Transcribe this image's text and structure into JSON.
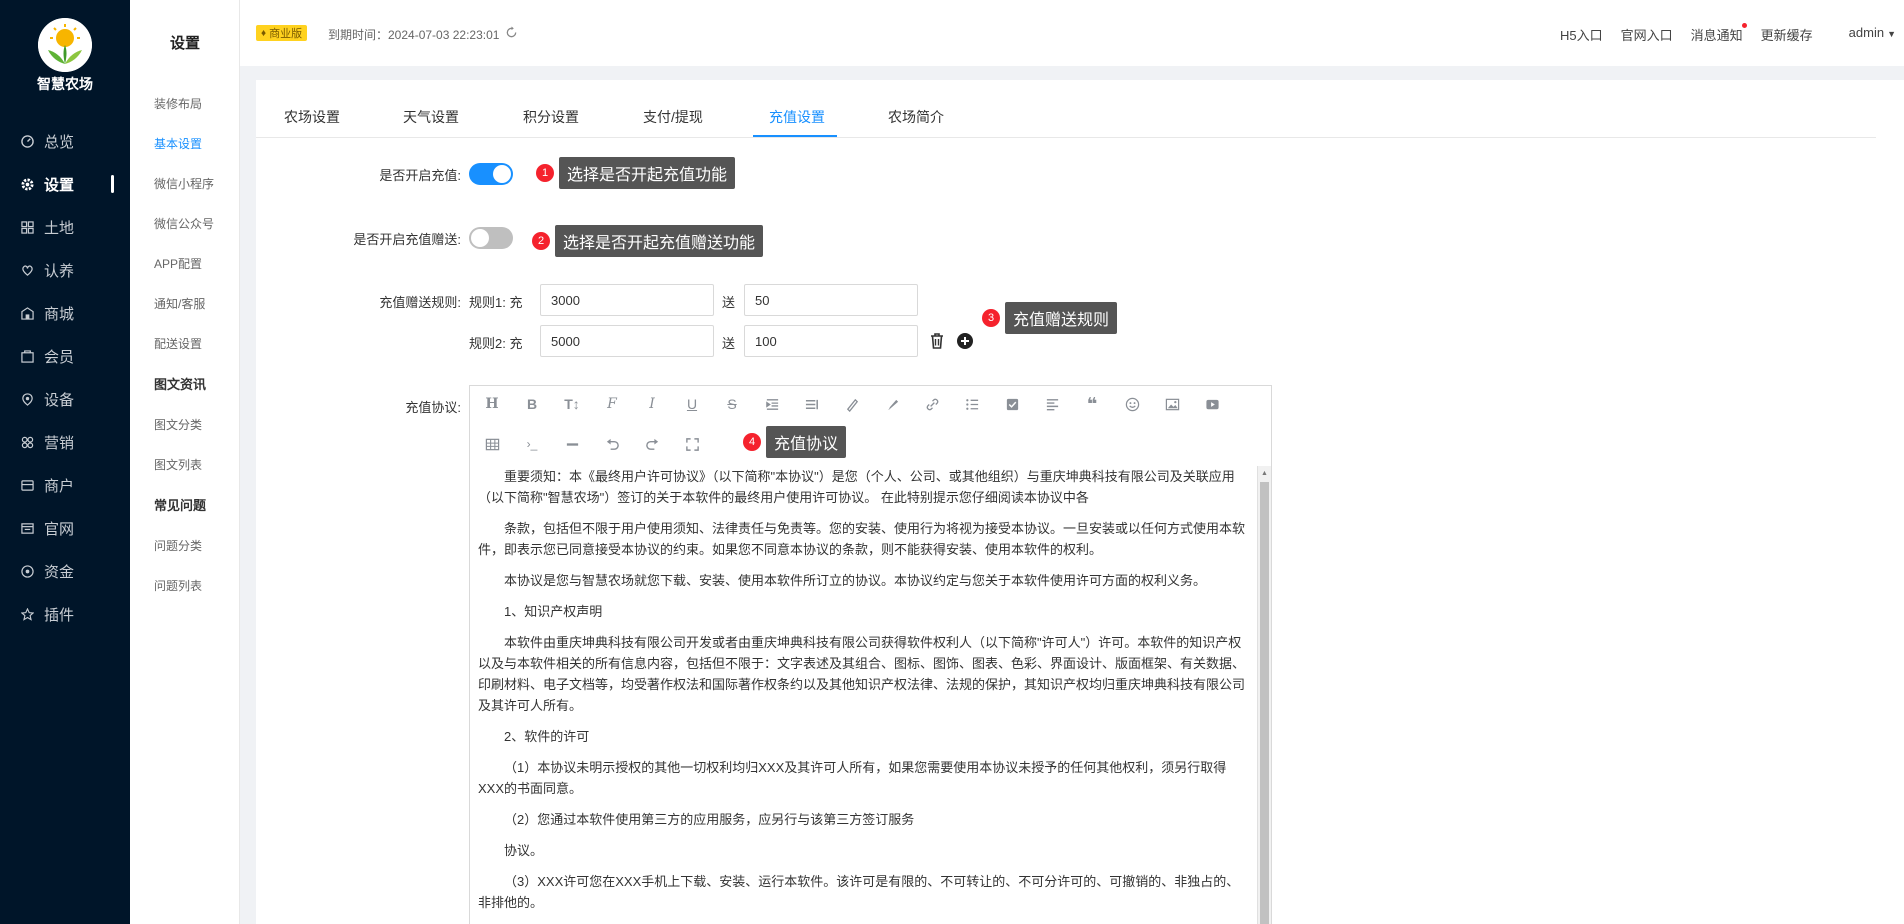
{
  "brand": {
    "name": "智慧农场"
  },
  "nav": {
    "items": [
      {
        "label": "总览",
        "icon": "dashboard-icon"
      },
      {
        "label": "设置",
        "icon": "gear-icon",
        "active": true
      },
      {
        "label": "土地",
        "icon": "grid-icon"
      },
      {
        "label": "认养",
        "icon": "adopt-icon"
      },
      {
        "label": "商城",
        "icon": "shop-icon"
      },
      {
        "label": "会员",
        "icon": "member-icon"
      },
      {
        "label": "设备",
        "icon": "device-icon"
      },
      {
        "label": "营销",
        "icon": "marketing-icon"
      },
      {
        "label": "商户",
        "icon": "merchant-icon"
      },
      {
        "label": "官网",
        "icon": "website-icon"
      },
      {
        "label": "资金",
        "icon": "funds-icon"
      },
      {
        "label": "插件",
        "icon": "star-icon"
      }
    ]
  },
  "subnav": {
    "title": "设置",
    "items": [
      "装修布局",
      "基本设置",
      "微信小程序",
      "微信公众号",
      "APP配置",
      "通知/客服",
      "配送设置"
    ],
    "group1": {
      "title": "图文资讯",
      "items": [
        "图文分类",
        "图文列表"
      ]
    },
    "group2": {
      "title": "常见问题",
      "items": [
        "问题分类",
        "问题列表"
      ]
    }
  },
  "header": {
    "badge": "商业版",
    "expire": "到期时间：2024-07-03 22:23:01",
    "links": [
      "H5入口",
      "官网入口",
      "消息通知",
      "更新缓存"
    ],
    "user": "admin"
  },
  "tabs": [
    "农场设置",
    "天气设置",
    "积分设置",
    "支付/提现",
    "充值设置",
    "农场简介"
  ],
  "form": {
    "enable_recharge_label": "是否开启充值:",
    "enable_gift_label": "是否开启充值赠送:",
    "rules_label": "充值赠送规则:",
    "rule1_prefix": "规则1: 充",
    "rule2_prefix": "规则2: 充",
    "send": "送",
    "rule1_amount": "3000",
    "rule1_gift": "50",
    "rule2_amount": "5000",
    "rule2_gift": "100",
    "agreement_label": "充值协议:"
  },
  "tips": [
    {
      "num": "1",
      "text": "选择是否开起充值功能"
    },
    {
      "num": "2",
      "text": "选择是否开起充值赠送功能"
    },
    {
      "num": "3",
      "text": "充值赠送规则"
    },
    {
      "num": "4",
      "text": "充值协议"
    }
  ],
  "agreement": [
    "重要须知：本《最终用户许可协议》（以下简称\"本协议\"）是您（个人、公司、或其他组织）与重庆坤典科技有限公司及关联应用（以下简称\"智慧农场\"）签订的关于本软件的最终用户使用许可协议。 在此特别提示您仔细阅读本协议中各",
    "条款，包括但不限于用户使用须知、法律责任与免责等。您的安装、使用行为将视为接受本协议。一旦安装或以任何方式使用本软件，即表示您已同意接受本协议的约束。如果您不同意本协议的条款，则不能获得安装、使用本软件的权利。",
    "本协议是您与智慧农场就您下载、安装、使用本软件所订立的协议。本协议约定与您关于本软件使用许可方面的权利义务。",
    "1、知识产权声明",
    "本软件由重庆坤典科技有限公司开发或者由重庆坤典科技有限公司获得软件权利人（以下简称\"许可人\"）许可。本软件的知识产权以及与本软件相关的所有信息内容，包括但不限于：文字表述及其组合、图标、图饰、图表、色彩、界面设计、版面框架、有关数据、印刷材料、电子文档等，均受著作权法和国际著作权条约以及其他知识产权法律、法规的保护，其知识产权均归重庆坤典科技有限公司及其许可人所有。",
    "2、软件的许可",
    "（1）本协议未明示授权的其他一切权利均归XXX及其许可人所有，如果您需要使用本协议未授予的任何其他权利，须另行取得XXX的书面同意。",
    "（2）您通过本软件使用第三方的应用服务，应另行与该第三方签订服务",
    "协议。",
    "（3）XXX许可您在XXX手机上下载、安装、运行本软件。该许可是有限的、不可转让的、不可分许可的、可撤销的、非独占的、非排他的。"
  ],
  "colors": {
    "accent": "#1890ff",
    "nav_bg": "#001529",
    "tip_bg": "#555555",
    "tip_num": "#f5222d",
    "badge": "#ffd21f"
  }
}
